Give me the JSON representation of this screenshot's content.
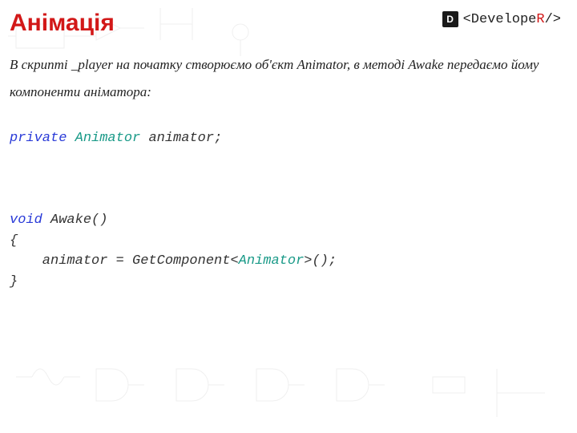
{
  "header": {
    "title": "Анімація",
    "logo_letter": "D",
    "logo_prefix": "<Develope",
    "logo_accent": "R",
    "logo_suffix": "/>"
  },
  "paragraph": {
    "text": "В скрипті _player на початку створюємо об'єкт Animator, в методі Awake передаємо йому компоненти аніматора:"
  },
  "code": {
    "kw_private": "private",
    "type_animator": "Animator",
    "decl_ident": " animator;",
    "kw_void": "void",
    "fn_awake": " Awake()",
    "brace_open": "{",
    "assign_pre": "    animator = GetComponent<",
    "assign_post": ">();",
    "brace_close": "}"
  }
}
